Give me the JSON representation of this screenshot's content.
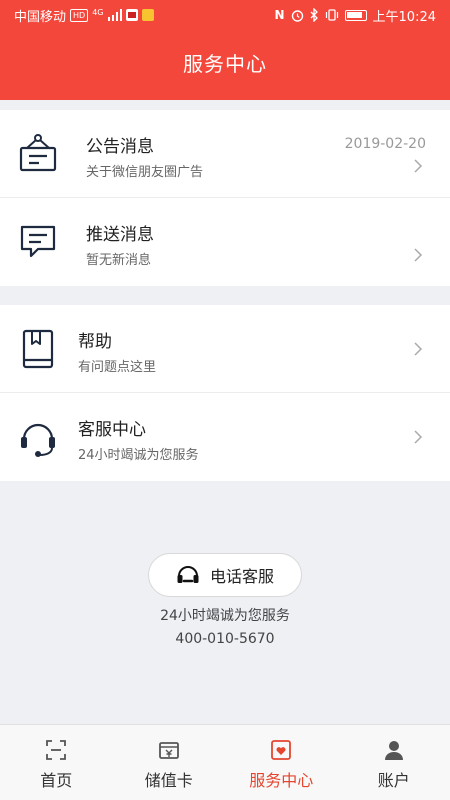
{
  "status_bar": {
    "carrier": "中国移动",
    "hd_badge": "HD",
    "network": "4G",
    "time": "上午10:24"
  },
  "header": {
    "title": "服务中心"
  },
  "messages": [
    {
      "title": "公告消息",
      "subtitle": "关于微信朋友圈广告",
      "date": "2019-02-20",
      "icon": "notice-board-icon"
    },
    {
      "title": "推送消息",
      "subtitle": "暂无新消息",
      "icon": "message-bubble-icon"
    }
  ],
  "support": [
    {
      "title": "帮助",
      "subtitle": "有问题点这里",
      "icon": "book-icon"
    },
    {
      "title": "客服中心",
      "subtitle": "24小时竭诚为您服务",
      "icon": "headset-icon"
    }
  ],
  "phone_service": {
    "button_label": "电话客服",
    "note": "24小时竭诚为您服务",
    "phone": "400-010-5670"
  },
  "tabs": [
    {
      "label": "首页",
      "icon": "home-scan-icon",
      "active": false
    },
    {
      "label": "储值卡",
      "icon": "card-wallet-icon",
      "active": false
    },
    {
      "label": "服务中心",
      "icon": "service-heart-icon",
      "active": true
    },
    {
      "label": "账户",
      "icon": "user-icon",
      "active": false
    }
  ],
  "colors": {
    "header_red": "#f4473c",
    "active_tab": "#e4462f",
    "icon_navy": "#1e2a3f"
  }
}
